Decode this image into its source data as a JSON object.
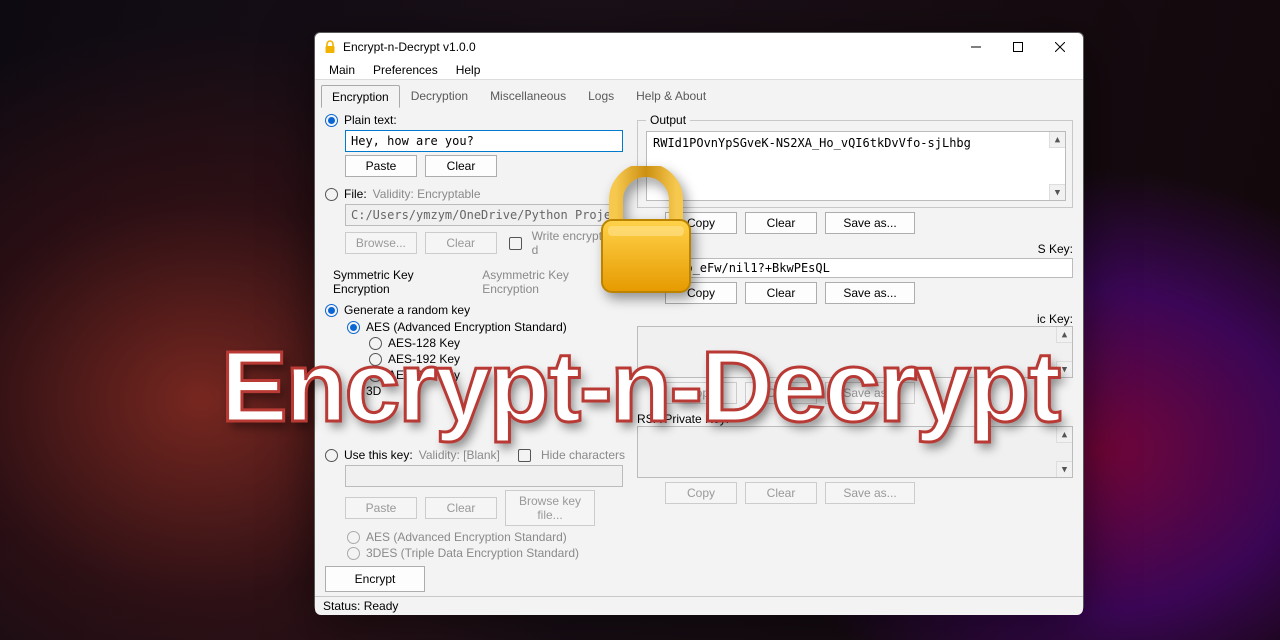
{
  "window": {
    "title": "Encrypt-n-Decrypt v1.0.0"
  },
  "menu": {
    "main": "Main",
    "preferences": "Preferences",
    "help": "Help"
  },
  "tabs": {
    "encryption": "Encryption",
    "decryption": "Decryption",
    "misc": "Miscellaneous",
    "logs": "Logs",
    "help_about": "Help & About"
  },
  "left": {
    "plain_label": "Plain text:",
    "plain_value": "Hey, how are you?",
    "paste": "Paste",
    "clear": "Clear",
    "file_label": "File:",
    "file_validity": "Validity: Encryptable",
    "file_path": "C:/Users/ymzym/OneDrive/Python Projects/Encrypt",
    "browse": "Browse...",
    "write_enc_label": "Write encrypted d",
    "subtab_sym": "Symmetric Key Encryption",
    "subtab_asym": "Asymmetric Key Encryption",
    "gen_random": "Generate a random key",
    "aes": "AES (Advanced Encryption Standard)",
    "aes128": "AES-128 Key",
    "aes192": "AES-192 Key",
    "aes256": "AES-256 Key",
    "three_des": "3D",
    "use_key_label": "Use this key:",
    "use_key_validity": "Validity: [Blank]",
    "hide_chars": "Hide characters",
    "browse_key": "Browse key file...",
    "aes_d": "AES (Advanced Encryption Standard)",
    "tdes_d": "3DES (Triple Data Encryption Standard)",
    "encrypt": "Encrypt"
  },
  "right": {
    "output_legend": "Output",
    "output_value": "RWId1POvnYpSGveK-NS2XA_Ho_vQI6tkDvVfo-sjLhbg",
    "copy": "Copy",
    "clear": "Clear",
    "saveas": "Save as...",
    "aes_key_suffix": "S Key:",
    "aes_key_value": "/C1V38o_eFw/nil1?+BkwPEsQL",
    "rsa_pub_suffix": "ic Key:",
    "rsa_priv": "RSA Private Key:"
  },
  "status": "Status: Ready",
  "brand": "Encrypt-n-Decrypt"
}
